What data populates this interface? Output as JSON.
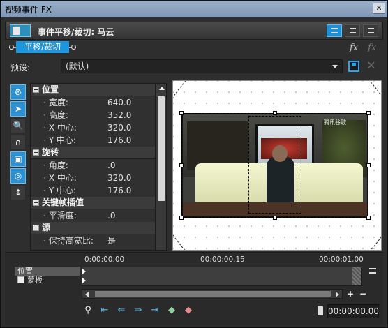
{
  "window": {
    "title": "视频事件 FX",
    "close_label": "✕"
  },
  "header": {
    "title": "事件平移/裁切: 马云"
  },
  "chain": {
    "plugin_label": "平移/裁切"
  },
  "preset": {
    "label": "预设:",
    "value": "(默认)"
  },
  "icons": {
    "fx_add": "fx-add-icon",
    "fx_remove": "fx-remove-icon",
    "save": "save-icon",
    "delete": "delete-icon"
  },
  "properties": {
    "sections": [
      {
        "title": "位置",
        "rows": [
          {
            "key": "宽度:",
            "value": "640.0"
          },
          {
            "key": "高度:",
            "value": "352.0"
          },
          {
            "key": "X 中心:",
            "value": "320.0"
          },
          {
            "key": "Y 中心:",
            "value": "176.0"
          }
        ]
      },
      {
        "title": "旋转",
        "rows": [
          {
            "key": "角度:",
            "value": ".0"
          },
          {
            "key": "X 中心:",
            "value": "320.0"
          },
          {
            "key": "Y 中心:",
            "value": "176.0"
          }
        ]
      },
      {
        "title": "关键帧插值",
        "rows": [
          {
            "key": "平滑度:",
            "value": ".0"
          }
        ]
      },
      {
        "title": "源",
        "rows": [
          {
            "key": "保持高宽比:",
            "value": "是"
          }
        ]
      }
    ]
  },
  "video": {
    "logo": "腾讯谷歌"
  },
  "timeline": {
    "tracks": [
      "位置",
      "蒙板"
    ],
    "ruler": [
      "0:00:00.00",
      "00:00:00.15",
      "00:00:01.00"
    ],
    "zoom_in": "+",
    "zoom_out": "−",
    "timecode": "00:00:00.00"
  }
}
